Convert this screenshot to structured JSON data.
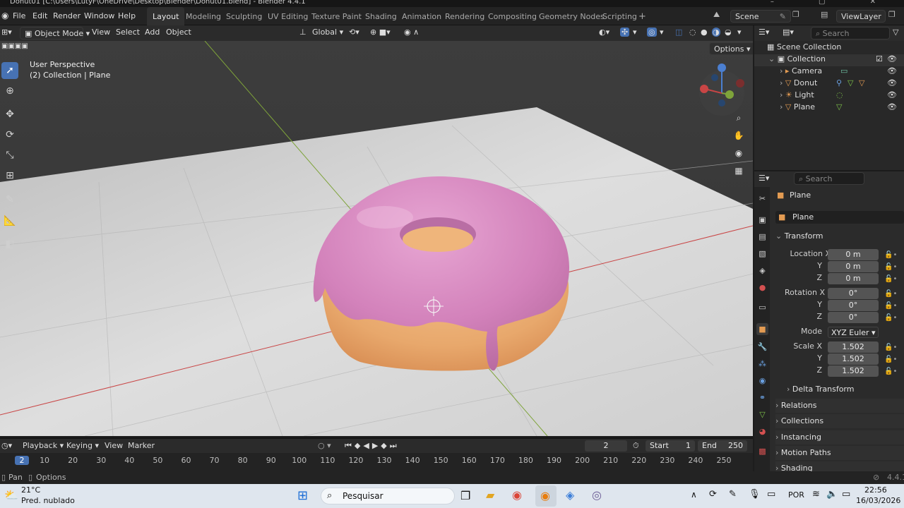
{
  "window": {
    "title": "Donut01 [C:\\Users\\LutyF\\OneDrive\\Desktop\\Blender\\Donut01.blend] - Blender 4.4.1"
  },
  "menus": [
    "File",
    "Edit",
    "Render",
    "Window",
    "Help"
  ],
  "workspaces": [
    "Layout",
    "Modeling",
    "Sculpting",
    "UV Editing",
    "Texture Paint",
    "Shading",
    "Animation",
    "Rendering",
    "Compositing",
    "Geometry Nodes",
    "Scripting"
  ],
  "active_workspace": "Layout",
  "scene": {
    "label": "Scene"
  },
  "viewlayer": {
    "label": "ViewLayer"
  },
  "viewport_header": {
    "mode": "Object Mode",
    "menus": [
      "View",
      "Select",
      "Add",
      "Object"
    ],
    "orientation": "Global",
    "options": "Options"
  },
  "viewport_overlay": {
    "line1": "User Perspective",
    "line2": "(2) Collection | Plane"
  },
  "outliner": {
    "search_placeholder": "Search",
    "root": "Scene Collection",
    "collection": "Collection",
    "items": [
      {
        "name": "Camera"
      },
      {
        "name": "Donut"
      },
      {
        "name": "Light"
      },
      {
        "name": "Plane"
      }
    ]
  },
  "properties": {
    "search_placeholder": "Search",
    "object_name": "Plane",
    "object_field": "Plane",
    "transform": {
      "title": "Transform",
      "location_label": "Location X",
      "location": [
        "0 m",
        "0 m",
        "0 m"
      ],
      "rotation_label": "Rotation X",
      "rotation": [
        "0°",
        "0°",
        "0°"
      ],
      "mode_label": "Mode",
      "mode": "XYZ Euler",
      "scale_label": "Scale X",
      "scale": [
        "1.502",
        "1.502",
        "1.502"
      ],
      "axis_y": "Y",
      "axis_z": "Z"
    },
    "delta_transform": "Delta Transform",
    "panels": [
      "Relations",
      "Collections",
      "Instancing",
      "Motion Paths",
      "Shading"
    ]
  },
  "timeline": {
    "menus": [
      "Playback",
      "Keying",
      "View",
      "Marker"
    ],
    "current_frame": "2",
    "start_label": "Start",
    "start": "1",
    "end_label": "End",
    "end": "250",
    "ticks": [
      "2",
      "10",
      "20",
      "30",
      "40",
      "50",
      "60",
      "70",
      "80",
      "90",
      "100",
      "110",
      "120",
      "130",
      "140",
      "150",
      "160",
      "170",
      "180",
      "190",
      "200",
      "210",
      "220",
      "230",
      "240",
      "250"
    ]
  },
  "statusbar": {
    "pan": "Pan",
    "options": "Options",
    "version": "4.4.1"
  },
  "taskbar": {
    "weather_temp": "21°C",
    "weather_desc": "Pred. nublado",
    "search": "Pesquisar",
    "lang": "POR",
    "time": "22:56",
    "date": "16/03/2026"
  },
  "colors": {
    "accent": "#4772b3",
    "frosting": "#d47fb6",
    "dough": "#e9a668",
    "floor": "#d9d9d9",
    "x_axis": "#c94545",
    "y_axis": "#7ea33a"
  }
}
